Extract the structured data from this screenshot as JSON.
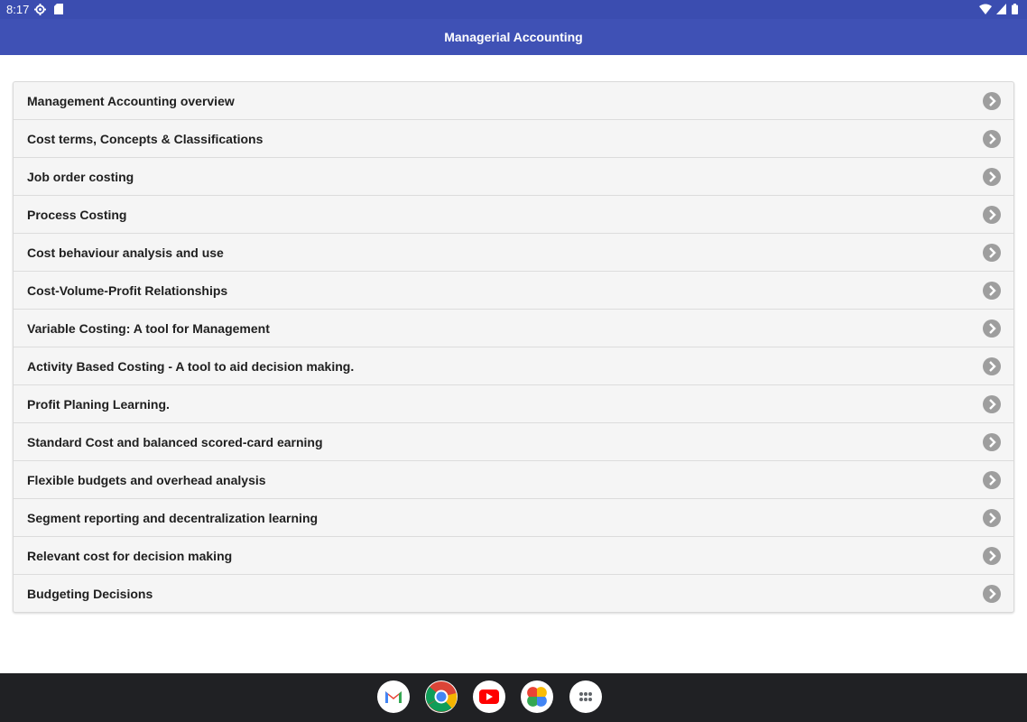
{
  "status": {
    "time": "8:17",
    "icons": [
      "settings-icon",
      "sd-card-icon",
      "wifi-icon",
      "signal-icon",
      "battery-icon"
    ]
  },
  "app": {
    "title": "Managerial Accounting",
    "accent": "#3f51b5"
  },
  "topics": [
    {
      "label": "Management Accounting overview"
    },
    {
      "label": "Cost terms, Concepts & Classifications"
    },
    {
      "label": "Job order costing"
    },
    {
      "label": "Process Costing"
    },
    {
      "label": "Cost behaviour analysis and use"
    },
    {
      "label": "Cost-Volume-Profit Relationships"
    },
    {
      "label": "Variable Costing: A tool for Management"
    },
    {
      "label": "Activity Based Costing - A tool to aid decision making."
    },
    {
      "label": "Profit Planing Learning."
    },
    {
      "label": "Standard Cost and balanced scored-card earning"
    },
    {
      "label": "Flexible budgets and overhead analysis"
    },
    {
      "label": "Segment reporting and decentralization learning"
    },
    {
      "label": "Relevant cost for decision making"
    },
    {
      "label": "Budgeting Decisions"
    }
  ],
  "dock": {
    "apps": [
      "gmail-icon",
      "chrome-icon",
      "youtube-icon",
      "photos-icon",
      "app-drawer-icon"
    ]
  }
}
